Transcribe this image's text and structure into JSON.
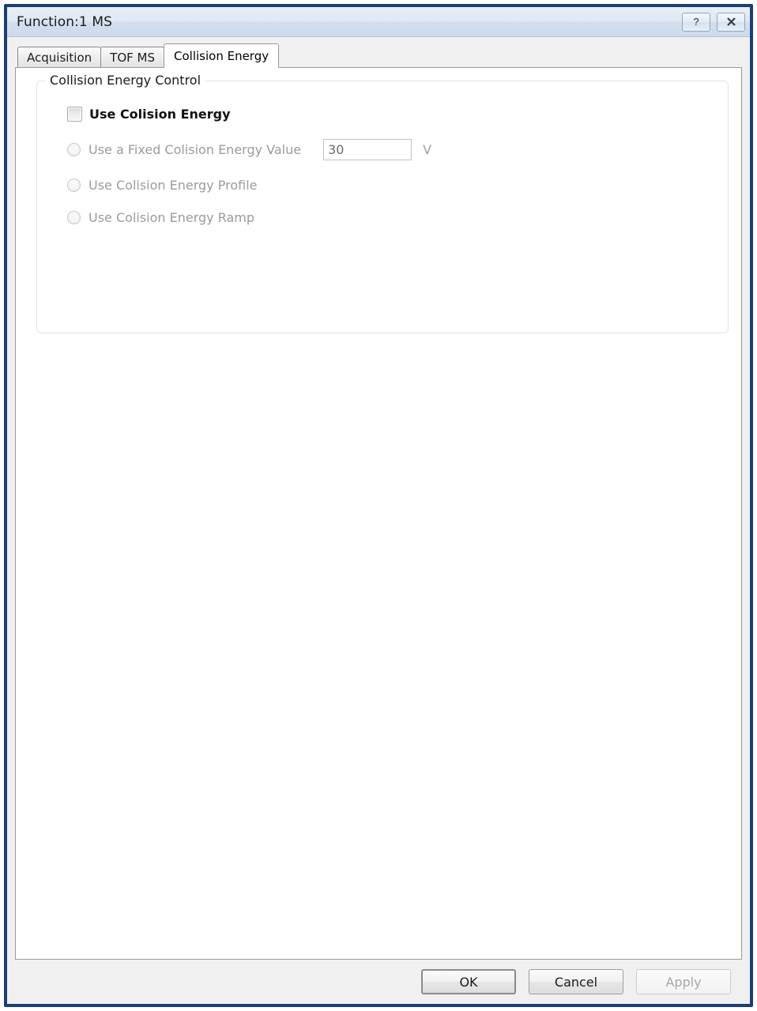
{
  "window": {
    "title": "Function:1 MS",
    "buttons": [
      {
        "name": "help-button",
        "glyph": "?"
      },
      {
        "name": "close-button",
        "glyph": "✖"
      }
    ],
    "border_color": "#1b3f72",
    "titlebar_color": "#dfe8f3"
  },
  "tabs": [
    {
      "label": "Acquisition",
      "active": false
    },
    {
      "label": "TOF MS",
      "active": false
    },
    {
      "label": "Collision Energy",
      "active": true
    }
  ],
  "group": {
    "title": "Collision Energy Control",
    "checkbox": {
      "label": "Use Colision Energy",
      "checked": false,
      "enabled": true
    },
    "options": [
      {
        "label": "Use a Fixed Colision Energy Value",
        "selected": false,
        "enabled": false,
        "value": "30",
        "unit": "V"
      },
      {
        "label": "Use Colision Energy Profile",
        "selected": false,
        "enabled": false
      },
      {
        "label": "Use Colision Energy Ramp",
        "selected": false,
        "enabled": false
      }
    ]
  },
  "footer": {
    "ok_label": "OK",
    "cancel_label": "Cancel",
    "apply_label": "Apply",
    "apply_enabled": false
  }
}
